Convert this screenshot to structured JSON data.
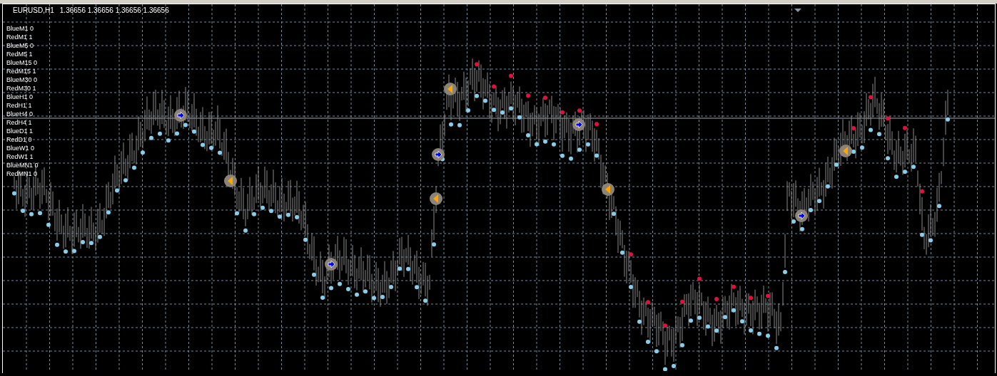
{
  "chart_header": {
    "symbol": "EURUSD,H1",
    "prices": "1.36656 1.36656 1.36656 1.36656"
  },
  "indicator_labels": [
    "BlueM1 0",
    "RedM1 1",
    "BlueM5 0",
    "RedM5 1",
    "BlueM15 0",
    "RedM15 1",
    "BlueM30 0",
    "RedM30 1",
    "BlueH1 0",
    "RedH1 1",
    "BlueH4 0",
    "RedH4 1",
    "BlueD1 1",
    "RedD1 0",
    "BlueW1 0",
    "RedW1 1",
    "BlueMN1 0",
    "RedMN1 0"
  ]
}
